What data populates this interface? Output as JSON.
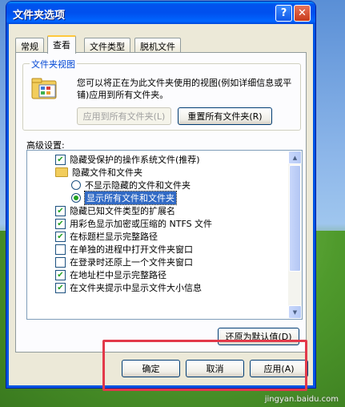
{
  "window": {
    "title": "文件夹选项",
    "help_label": "?",
    "close_label": "✕"
  },
  "tabs": [
    {
      "label": "常规",
      "active": false
    },
    {
      "label": "查看",
      "active": true
    },
    {
      "label": "文件类型",
      "active": false
    },
    {
      "label": "脱机文件",
      "active": false
    }
  ],
  "folder_views": {
    "group_label": "文件夹视图",
    "description": "您可以将正在为此文件夹使用的视图(例如详细信息或平铺)应用到所有文件夹。",
    "apply_all_label": "应用到所有文件夹(L)",
    "reset_all_label": "重置所有文件夹(R)",
    "icon": "folder-view-icon"
  },
  "advanced": {
    "label": "高级设置:",
    "items": [
      {
        "type": "checkbox",
        "checked": true,
        "label": "隐藏受保护的操作系统文件(推荐)",
        "indent": 0
      },
      {
        "type": "folder",
        "label": "隐藏文件和文件夹",
        "indent": 0
      },
      {
        "type": "radio",
        "checked": false,
        "label": "不显示隐藏的文件和文件夹",
        "indent": 1
      },
      {
        "type": "radio",
        "checked": true,
        "label": "显示所有文件和文件夹",
        "indent": 1,
        "selected": true
      },
      {
        "type": "checkbox",
        "checked": true,
        "label": "隐藏已知文件类型的扩展名",
        "indent": 0
      },
      {
        "type": "checkbox",
        "checked": true,
        "label": "用彩色显示加密或压缩的 NTFS 文件",
        "indent": 0
      },
      {
        "type": "checkbox",
        "checked": true,
        "label": "在标题栏显示完整路径",
        "indent": 0
      },
      {
        "type": "checkbox",
        "checked": false,
        "label": "在单独的进程中打开文件夹窗口",
        "indent": 0
      },
      {
        "type": "checkbox",
        "checked": false,
        "label": "在登录时还原上一个文件夹窗口",
        "indent": 0
      },
      {
        "type": "checkbox",
        "checked": true,
        "label": "在地址栏中显示完整路径",
        "indent": 0
      },
      {
        "type": "checkbox",
        "checked": true,
        "label": "在文件夹提示中显示文件大小信息",
        "indent": 0
      }
    ],
    "restore_defaults_label": "还原为默认值(D)"
  },
  "footer": {
    "ok_label": "确定",
    "cancel_label": "取消",
    "apply_label": "应用(A)"
  },
  "watermark": "jingyan.baidu.com",
  "colors": {
    "titlebar": "#0054e3",
    "highlight_frame": "#e2394a",
    "selection": "#316ac5"
  }
}
